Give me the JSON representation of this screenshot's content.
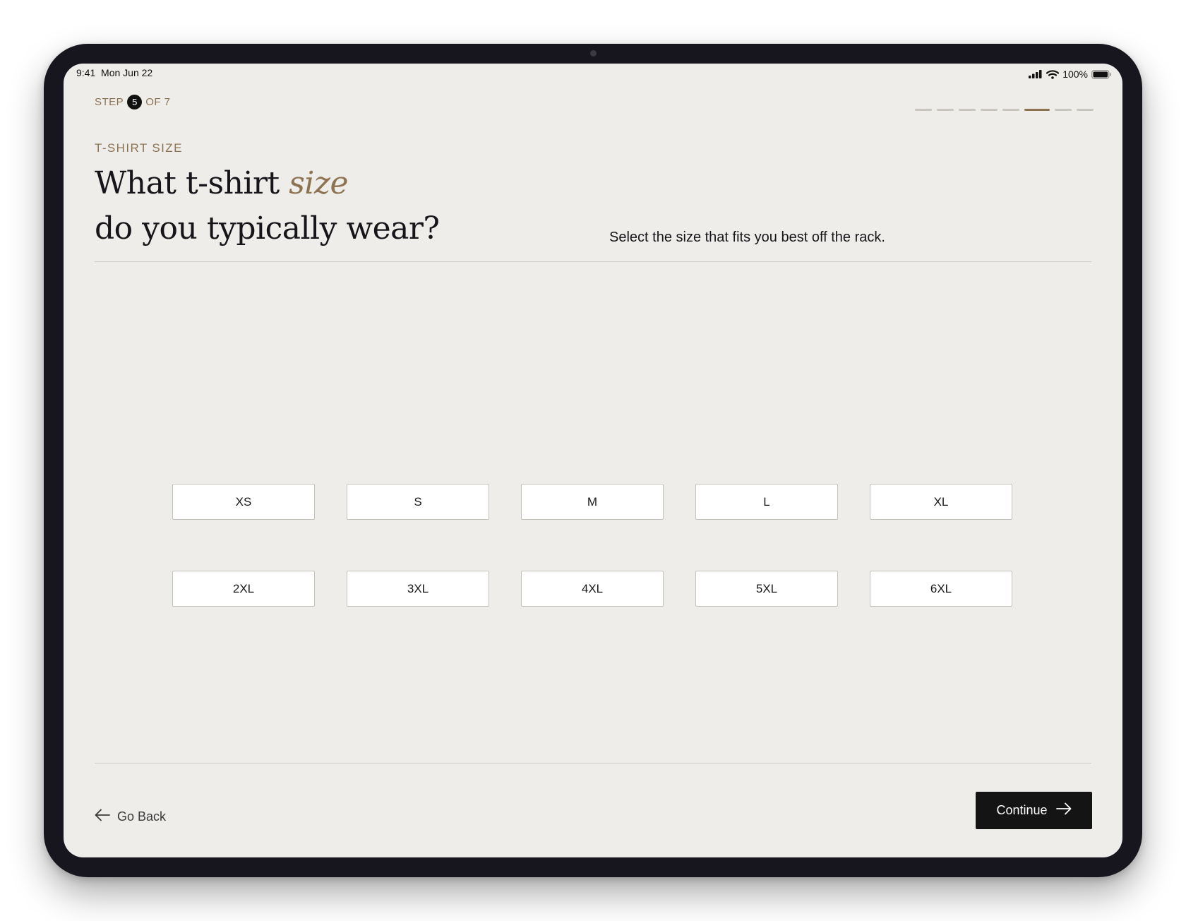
{
  "status_bar": {
    "time": "9:41",
    "date": "Mon Jun 22",
    "battery": "100%",
    "icons": [
      "signal-icon",
      "wifi-icon",
      "battery-icon"
    ]
  },
  "step": {
    "prefix": "STEP",
    "current": "5",
    "suffix": "OF 7",
    "total_segments": 8,
    "active_segment": 6
  },
  "question": {
    "label": "T-SHIRT SIZE",
    "title_start": "What t-shirt",
    "title_accent": "size",
    "title_end": "do you typically wear?",
    "subtitle": "Select the size that fits you best off the rack."
  },
  "sizes": [
    "XS",
    "S",
    "M",
    "L",
    "XL",
    "2XL",
    "3XL",
    "4XL",
    "5XL",
    "6XL"
  ],
  "footer": {
    "back_label": "Go Back",
    "continue_label": "Continue"
  },
  "colors": {
    "accent": "#8d7352",
    "background": "#eeedea",
    "primary_button": "#141414",
    "bezel": "#17161e"
  }
}
